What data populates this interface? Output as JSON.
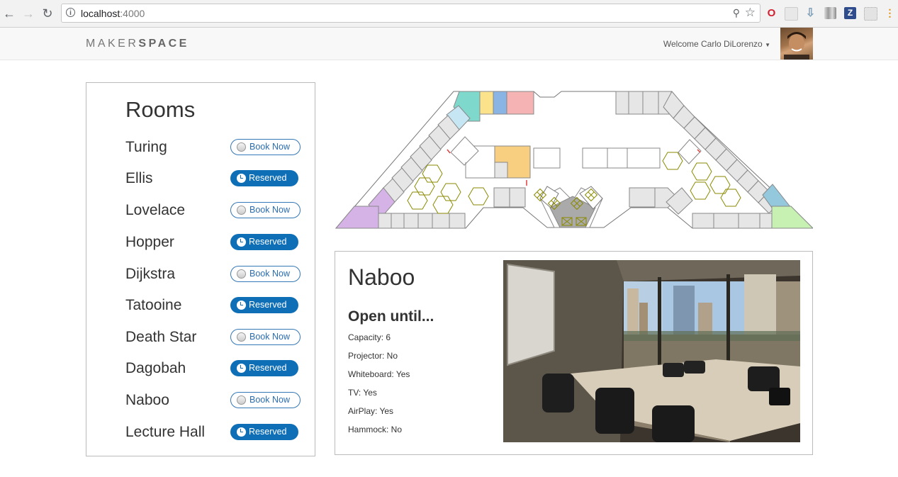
{
  "browser": {
    "url_host": "localhost",
    "url_port": ":4000"
  },
  "app": {
    "brand_part1": "MAKER",
    "brand_part2": "SPACE",
    "welcome": "Welcome Carlo DiLorenzo"
  },
  "rooms": {
    "title": "Rooms",
    "items": [
      {
        "name": "Turing",
        "status": "Book Now"
      },
      {
        "name": "Ellis",
        "status": "Reserved"
      },
      {
        "name": "Lovelace",
        "status": "Book Now"
      },
      {
        "name": "Hopper",
        "status": "Reserved"
      },
      {
        "name": "Dijkstra",
        "status": "Book Now"
      },
      {
        "name": "Tatooine",
        "status": "Reserved"
      },
      {
        "name": "Death Star",
        "status": "Book Now"
      },
      {
        "name": "Dagobah",
        "status": "Reserved"
      },
      {
        "name": "Naboo",
        "status": "Book Now"
      },
      {
        "name": "Lecture Hall",
        "status": "Reserved"
      }
    ]
  },
  "detail": {
    "title": "Naboo",
    "subtitle": "Open until...",
    "properties": [
      "Capacity: 6",
      "Projector: No",
      "Whiteboard: Yes",
      "TV: Yes",
      "AirPlay: Yes",
      "Hammock: No"
    ]
  },
  "colors": {
    "primary": "#0e6fb7",
    "navbar_bg": "#f8f8f8",
    "room_teal": "#7fd8cc",
    "room_yellow": "#fbe38c",
    "room_blue": "#8ab4e4",
    "room_pink": "#f6b3b3",
    "room_lightblue": "#c6e6f3",
    "room_orange": "#f8cf80",
    "room_purple": "#d5b3e6",
    "room_green": "#c7f0b3",
    "room_steel": "#93c8dd",
    "room_grey": "#e6e6e6"
  }
}
